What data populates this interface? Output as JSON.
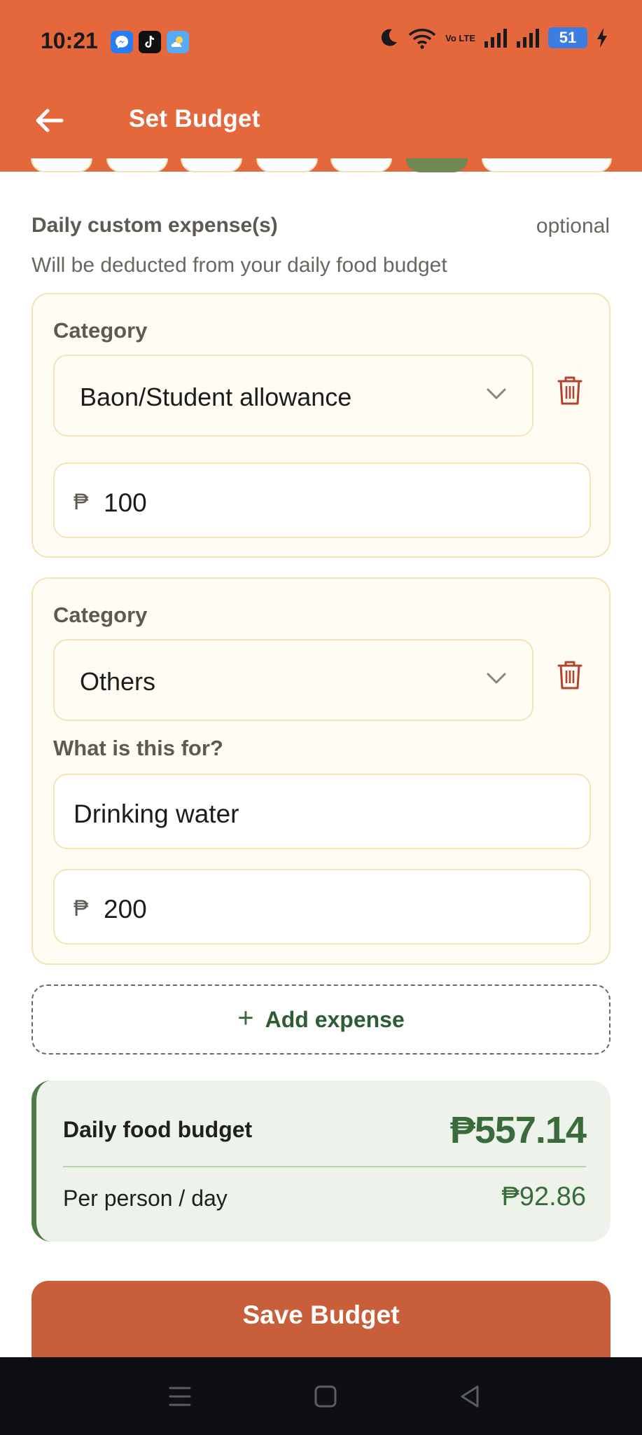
{
  "status_bar": {
    "time": "10:21",
    "notification_icons": [
      "messenger-icon",
      "tiktok-icon",
      "weather-icon"
    ],
    "volte_label": "Vo LTE",
    "battery": "51"
  },
  "header": {
    "title": "Set Budget",
    "color": "#e5683c"
  },
  "custom_expenses": {
    "label": "Daily custom expense(s)",
    "optional": "optional",
    "subtext": "Will be deducted from your daily food budget",
    "items": [
      {
        "category_label": "Category",
        "category_value": "Baon/Student allowance",
        "currency": "₱",
        "amount": "100"
      },
      {
        "category_label": "Category",
        "category_value": "Others",
        "purpose_label": "What is this for?",
        "purpose_value": "Drinking water",
        "currency": "₱",
        "amount": "200"
      }
    ],
    "add_label": "Add expense"
  },
  "summary": {
    "daily_label": "Daily food budget",
    "daily_value": "₱557.14",
    "per_person_label": "Per person / day",
    "per_person_value": "₱92.86"
  },
  "save_label": "Save Budget",
  "colors": {
    "accent": "#e5683c",
    "save": "#c85e3a",
    "green": "#3a6b3a",
    "card_border": "#f2e3b8"
  }
}
